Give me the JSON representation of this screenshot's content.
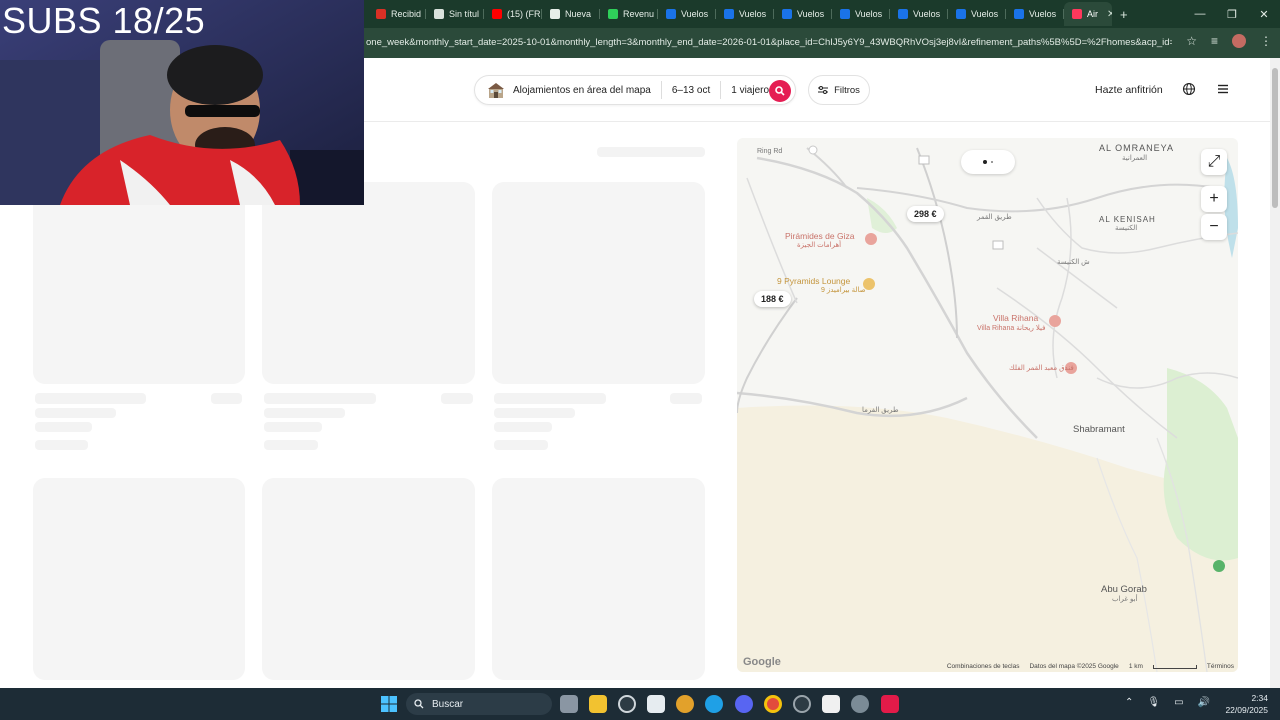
{
  "overlay": {
    "title": "SUBS 18/25"
  },
  "browser": {
    "tabs": [
      {
        "label": "Recibid",
        "icon": "gmail-icon",
        "color": "#d93025"
      },
      {
        "label": "Sin títul",
        "icon": "notion-icon",
        "color": "#d9e2dc"
      },
      {
        "label": "(15) (FR",
        "icon": "youtube-icon",
        "color": "#ff0000"
      },
      {
        "label": "Nueva",
        "icon": "github-icon",
        "color": "#e7efe9"
      },
      {
        "label": "Revenu",
        "icon": "k-icon",
        "color": "#2fd05a"
      },
      {
        "label": "Vuelos",
        "icon": "flights-icon",
        "color": "#1a73e8"
      },
      {
        "label": "Vuelos",
        "icon": "flights-icon",
        "color": "#1a73e8"
      },
      {
        "label": "Vuelos",
        "icon": "flights-icon",
        "color": "#1a73e8"
      },
      {
        "label": "Vuelos",
        "icon": "flights-icon",
        "color": "#1a73e8"
      },
      {
        "label": "Vuelos",
        "icon": "flights-icon",
        "color": "#1a73e8"
      },
      {
        "label": "Vuelos",
        "icon": "flights-icon",
        "color": "#1a73e8"
      },
      {
        "label": "Vuelos",
        "icon": "flights-icon",
        "color": "#1a73e8"
      }
    ],
    "active_tab": {
      "label": "Air",
      "icon": "airbnb-icon",
      "color": "#ff385c"
    },
    "url": "one_week&monthly_start_date=2025-10-01&monthly_length=3&monthly_end_date=2026-01-01&place_id=ChIJ5y6Y9_43WBQRhVOsj3ej8vI&refinement_paths%5B%5D=%2Fhomes&acp_id=29..."
  },
  "header": {
    "location": "Alojamientos en área del mapa",
    "dates": "6–13 oct",
    "guests": "1 viajero",
    "filters": "Filtros",
    "host": "Hazte anfitrión"
  },
  "map": {
    "price_pins": [
      {
        "label": "298 €"
      },
      {
        "label": "188 €"
      }
    ],
    "places": {
      "al_omraneya": "AL OMRANEYA",
      "al_omraneya_ar": "العمرانية",
      "al_kenisah": "AL KENISAH",
      "al_kenisah_ar": "الكنيسة",
      "shabramant": "Shabramant",
      "abu_gorab": "Abu Gorab",
      "abu_gorab_ar": "أبو غراب",
      "pyramids": "Pirámides de Giza",
      "pyramids_ar": "أهرامات الجيزة",
      "lounge": "9 Pyramids Lounge",
      "lounge_ar": "9 صالة بيراميدز",
      "villa": "Villa Rihana",
      "villa_ar": "Villa Rihana فيلا ريحانة",
      "hotel_ar": "فندق معبد القمر الفلك",
      "ring_road": "Ring Rd",
      "road_ar": "طريق الفرما",
      "road_ar2": "طريق القمر",
      "road_ar3": "ش الكنيسة"
    },
    "footer": {
      "shortcuts": "Combinaciones de teclas",
      "mapdata": "Datos del mapa ©2025 Google",
      "scale": "1 km",
      "terms": "Términos"
    },
    "logo": "Google"
  },
  "taskbar": {
    "search": "Buscar",
    "time": "2:34",
    "date": "22/09/2025"
  }
}
